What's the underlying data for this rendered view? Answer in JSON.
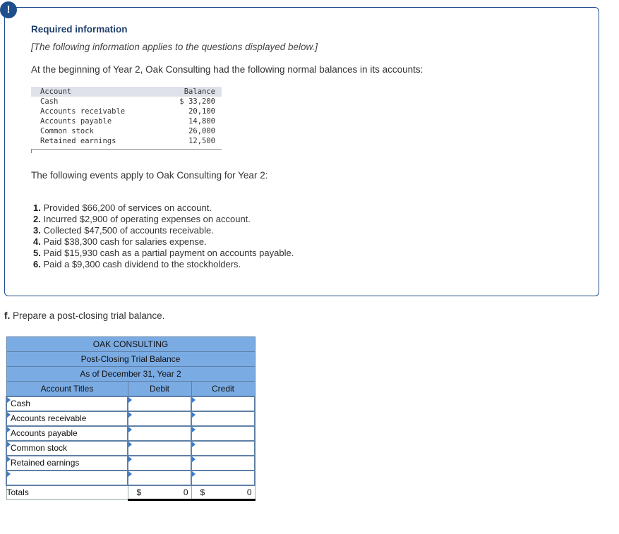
{
  "alert_icon": "exclamation-icon",
  "alert_symbol": "!",
  "required_title": "Required information",
  "required_note": "[The following information applies to the questions displayed below.]",
  "intro": "At the beginning of Year 2, Oak Consulting had the following normal balances in its accounts:",
  "balances": {
    "headers": [
      "Account",
      "Balance"
    ],
    "rows": [
      {
        "account": "Cash",
        "balance": "$ 33,200"
      },
      {
        "account": "Accounts receivable",
        "balance": "20,100"
      },
      {
        "account": "Accounts payable",
        "balance": "14,800"
      },
      {
        "account": "Common stock",
        "balance": "26,000"
      },
      {
        "account": "Retained earnings",
        "balance": "12,500"
      }
    ]
  },
  "events_intro": "The following events apply to Oak Consulting for Year 2:",
  "events": [
    {
      "num": "1.",
      "text": "Provided $66,200 of services on account."
    },
    {
      "num": "2.",
      "text": "Incurred $2,900 of operating expenses on account."
    },
    {
      "num": "3.",
      "text": "Collected $47,500 of accounts receivable."
    },
    {
      "num": "4.",
      "text": "Paid $38,300 cash for salaries expense."
    },
    {
      "num": "5.",
      "text": "Paid $15,930 cash as a partial payment on accounts payable."
    },
    {
      "num": "6.",
      "text": "Paid a $9,300 cash dividend to the stockholders."
    }
  ],
  "question": {
    "label": "f.",
    "text": "Prepare a post-closing trial balance."
  },
  "trial_balance": {
    "company": "OAK CONSULTING",
    "statement": "Post-Closing Trial Balance",
    "date": "As of December 31, Year 2",
    "col_headers": [
      "Account Titles",
      "Debit",
      "Credit"
    ],
    "rows": [
      {
        "title": "Cash",
        "debit": "",
        "credit": ""
      },
      {
        "title": "Accounts receivable",
        "debit": "",
        "credit": ""
      },
      {
        "title": "Accounts payable",
        "debit": "",
        "credit": ""
      },
      {
        "title": "Common stock",
        "debit": "",
        "credit": ""
      },
      {
        "title": "Retained earnings",
        "debit": "",
        "credit": ""
      },
      {
        "title": "",
        "debit": "",
        "credit": ""
      }
    ],
    "totals": {
      "label": "Totals",
      "debit_symbol": "$",
      "debit": "0",
      "credit_symbol": "$",
      "credit": "0"
    }
  }
}
